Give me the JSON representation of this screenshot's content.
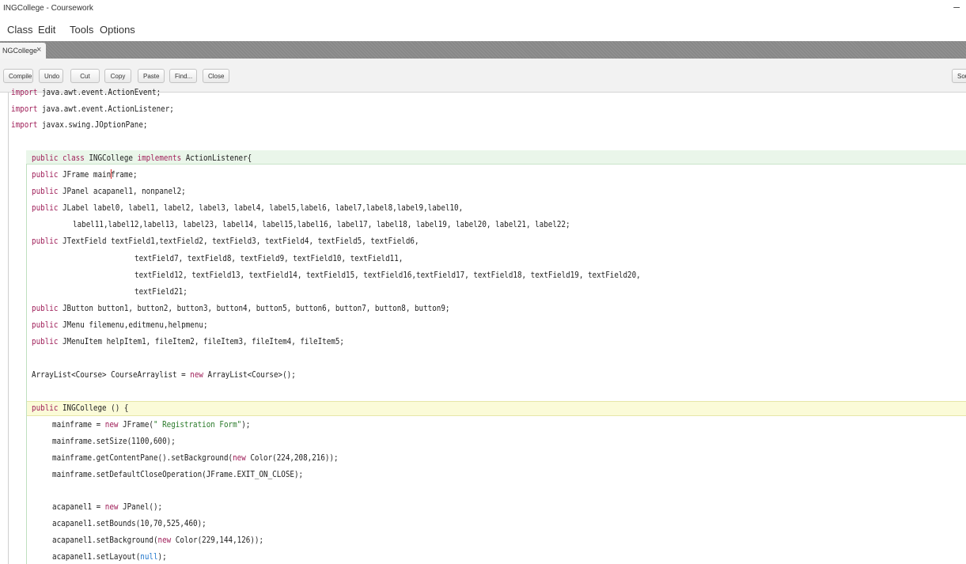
{
  "window": {
    "title": "INGCollege - Coursework",
    "minimize_glyph": "–"
  },
  "menu": {
    "items": [
      "Class",
      "Edit",
      "Tools",
      "Options"
    ]
  },
  "tab": {
    "label": "NGCollege",
    "close_glyph": "×"
  },
  "toolbar": {
    "buttons": [
      "Compile",
      "Undo",
      "Cut",
      "Copy",
      "Paste",
      "Find...",
      "Close"
    ],
    "right_button": "Sour"
  },
  "code": {
    "lines": [
      "import java.awt.event.ActionEvent;",
      "import java.awt.event.ActionListener;",
      "import javax.swing.JOptionPane;",
      "",
      "public class INGCollege implements ActionListener{",
      "public JFrame mainframe;",
      "public JPanel acapanel1, nonpanel2;",
      "public JLabel label0, label1, label2, label3, label4, label5,label6, label7,label8,label9,label10,",
      "label11,label12,label13, label23, label14, label15,label16, label17, label18, label19, label20, label21, label22;",
      "public JTextField textField1,textField2, textField3, textField4, textField5, textField6,",
      "textField7, textField8, textField9, textField10, textField11,",
      "textField12, textField13, textField14, textField15, textField16,textField17, textField18, textField19, textField20,",
      "textField21;",
      "public JButton button1, button2, button3, button4, button5, button6, button7, button8, button9;",
      "public JMenu filemenu,editmenu,helpmenu;",
      "public JMenuItem helpItem1, fileItem2, fileItem3, fileItem4, fileItem5;",
      "",
      "ArrayList<Course> CourseArraylist = new ArrayList<Course>();",
      "",
      "public INGCollege () {",
      "mainframe = new JFrame(\" Registration Form\");",
      "mainframe.setSize(1100,600);",
      "mainframe.getContentPane().setBackground(new Color(224,208,216));",
      "mainframe.setDefaultCloseOperation(JFrame.EXIT_ON_CLOSE);",
      "",
      "acapanel1 = new JPanel();",
      "acapanel1.setBounds(10,70,525,460);",
      "acapanel1.setBackground(new Color(229,144,126));",
      "acapanel1.setLayout(null);"
    ]
  }
}
